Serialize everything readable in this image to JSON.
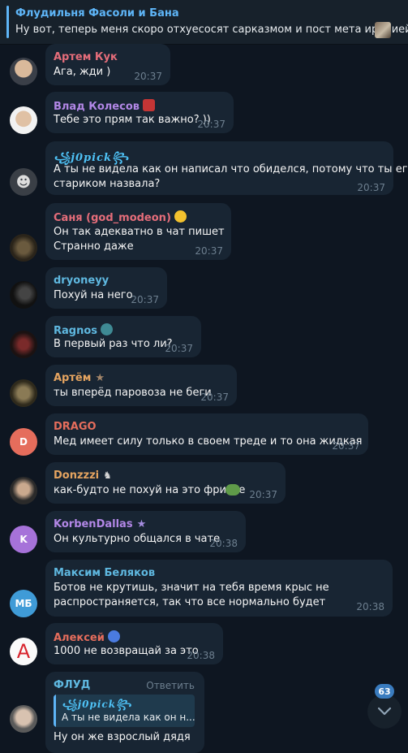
{
  "pinned": {
    "title": "Флудильня Фасоли и Бана",
    "text": "Ну вот, теперь меня скоро отхуесосят сарказмом и пост мета иронией"
  },
  "messages": [
    {
      "name": "Артем Кук",
      "text": "Ага, жди )",
      "time": "20:37",
      "color": "#e56d7a"
    },
    {
      "name": "Влад Колесов",
      "text": "Тебе это прям так важно? ))",
      "time": "20:37",
      "color": "#b287e6"
    },
    {
      "name": "꧁j0pick꧂",
      "lines": [
        "А ты не видела как он написал что обиделся, потому что ты его",
        "стариком назвала?"
      ],
      "time": "20:37",
      "color": "#4fc3f7"
    },
    {
      "name": "Саня (god_modeon)",
      "lines": [
        "Он так адекватно в чат пишет",
        "Странно даже"
      ],
      "time": "20:37",
      "color": "#e56d7a"
    },
    {
      "name": "dryoneyy",
      "text": "Похуй на него",
      "time": "20:37",
      "color": "#5fb8e0"
    },
    {
      "name": "Ragnos",
      "text": "В первый раз что ли?",
      "time": "20:37",
      "color": "#5fb8e0"
    },
    {
      "name": "Артём",
      "text": "ты вперёд паровоза не беги",
      "time": "20:37",
      "color": "#e5a460"
    },
    {
      "name": "DRAGO",
      "text": "Мед имеет силу только в своем треде и то она жидкая",
      "time": "20:37",
      "color": "#e56d5c",
      "initial": "D"
    },
    {
      "name": "Donzzzi",
      "text": "как-будто не похуй на это фричье",
      "time": "20:37",
      "color": "#e5a460"
    },
    {
      "name": "KorbenDallas",
      "text": "Он культурно общался в чате",
      "time": "20:38",
      "color": "#b287e6",
      "initial": "K"
    },
    {
      "name": "Максим Беляков",
      "lines": [
        "Ботов не крутишь, значит на тебя время крыс не",
        "распространяется, так что все нормально будет"
      ],
      "time": "20:38",
      "color": "#5fb8e0",
      "initial": "МБ"
    },
    {
      "name": "Алексей",
      "text": "1000 не возвращай за это",
      "time": "20:38",
      "color": "#e56d5c",
      "initial": "A"
    },
    {
      "name": "ФЛУД",
      "reply_label": "Ответить",
      "reply_name": "꧁j0pick꧂",
      "reply_text": "А ты не видела как он н...",
      "text": "Ну он же взрослый дядя",
      "color": "#5fb8e0"
    }
  ],
  "unread_count": "63",
  "icons": {
    "scroll": "chevron-down-icon"
  }
}
